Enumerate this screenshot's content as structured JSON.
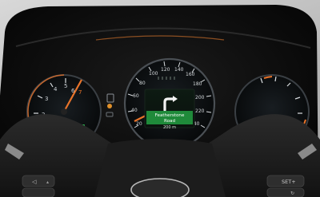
{
  "speedometer": {
    "scale": [
      "20",
      "40",
      "60",
      "80",
      "100",
      "120",
      "140",
      "160",
      "180",
      "200",
      "220",
      "240"
    ]
  },
  "tachometer": {
    "scale": [
      "1",
      "2",
      "3",
      "4",
      "5",
      "6",
      "7"
    ]
  },
  "navigation": {
    "street_line1": "Featherstone",
    "street_line2": "Road",
    "distance": "200 m"
  },
  "steering_controls": {
    "right_label": "SET+"
  },
  "icons": [
    "turn-arrow-icon",
    "fuel-pump-icon",
    "engine-warning-icon",
    "lane-assist-icon",
    "check-light-icon"
  ],
  "colors": {
    "needle_orange": "#e8732a",
    "nav_green": "#1f8a3a",
    "cluster_bg": "#0a0a0a"
  }
}
